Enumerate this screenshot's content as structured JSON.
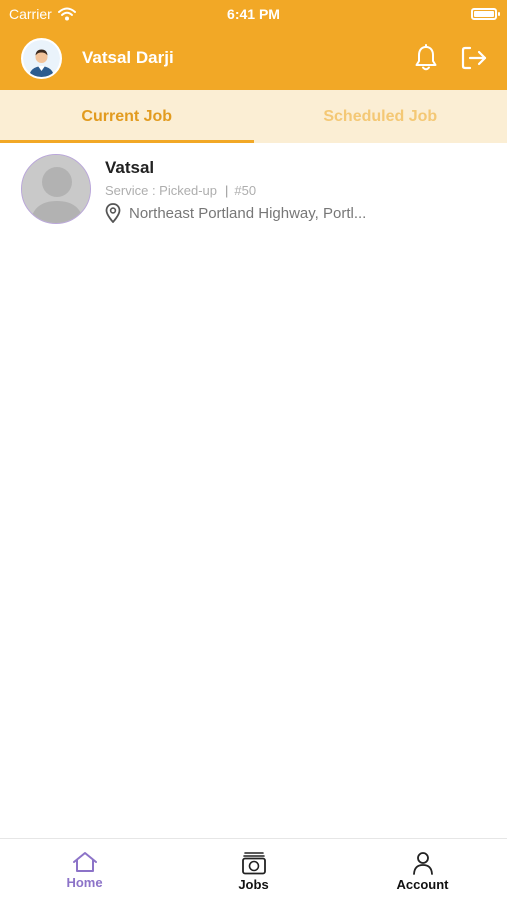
{
  "status_bar": {
    "carrier": "Carrier",
    "time": "6:41 PM",
    "battery_level": 1.0
  },
  "header": {
    "user_name": "Vatsal Darji",
    "bell_icon": "bell-icon",
    "logout_icon": "logout-icon"
  },
  "tabs": [
    {
      "label": "Current Job",
      "active": true
    },
    {
      "label": "Scheduled Job",
      "active": false
    }
  ],
  "jobs": [
    {
      "name": "Vatsal",
      "service": "Service : Picked-up",
      "number": "#50",
      "address": "Northeast Portland Highway, Portl..."
    }
  ],
  "tabbar": {
    "items": [
      {
        "label": "Home",
        "icon": "home-icon",
        "active": true
      },
      {
        "label": "Jobs",
        "icon": "jobs-icon",
        "active": false
      },
      {
        "label": "Account",
        "icon": "account-icon",
        "active": false
      }
    ]
  },
  "colors": {
    "brand": "#F2A826",
    "tab_bg": "#FBEED4",
    "active_tab": "#E29B1F",
    "inactive_tab": "#F4C875",
    "home_active": "#8C73C8"
  }
}
